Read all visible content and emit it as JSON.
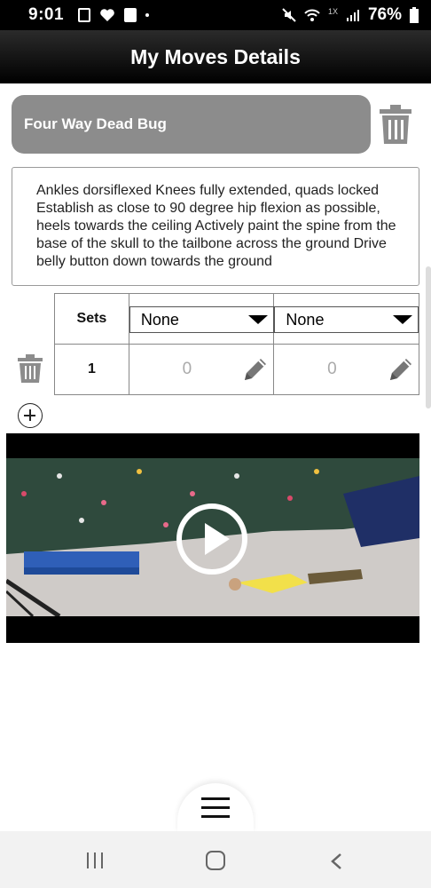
{
  "status_bar": {
    "time": "9:01",
    "battery": "76%",
    "network": "1X"
  },
  "header": {
    "title": "My Moves Details"
  },
  "move": {
    "name": "Four Way Dead Bug",
    "description": "Ankles dorsiflexed Knees fully extended, quads locked Establish as close to 90 degree hip flexion as possible, heels towards the ceiling Actively paint the spine from the base of the skull to the tailbone across the ground Drive belly button down towards the ground"
  },
  "sets_table": {
    "header_label": "Sets",
    "columns": [
      {
        "selected": "None"
      },
      {
        "selected": "None"
      }
    ],
    "rows": [
      {
        "set": "1",
        "values": [
          "0",
          "0"
        ]
      }
    ]
  },
  "colors": {
    "name_box": "#8c8c8c",
    "app_bar": "#000000"
  },
  "icons": [
    "trash-icon",
    "pencil-icon",
    "add-circle-icon",
    "play-icon",
    "menu-icon",
    "recent-apps-icon",
    "home-icon",
    "back-icon"
  ]
}
